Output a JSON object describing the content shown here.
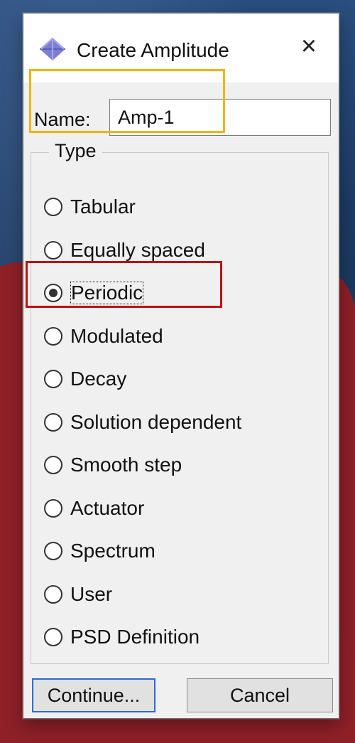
{
  "dialog": {
    "title": "Create Amplitude",
    "close_icon": "close-icon",
    "icon": "amplitude-diamond-icon",
    "name_label": "Name:",
    "name_value": "Amp-1",
    "type_label": "Type",
    "options": [
      {
        "label": "Tabular",
        "selected": false
      },
      {
        "label": "Equally spaced",
        "selected": false
      },
      {
        "label": "Periodic",
        "selected": true
      },
      {
        "label": "Modulated",
        "selected": false
      },
      {
        "label": "Decay",
        "selected": false
      },
      {
        "label": "Solution dependent",
        "selected": false
      },
      {
        "label": "Smooth step",
        "selected": false
      },
      {
        "label": "Actuator",
        "selected": false
      },
      {
        "label": "Spectrum",
        "selected": false
      },
      {
        "label": "User",
        "selected": false
      },
      {
        "label": "PSD Definition",
        "selected": false
      }
    ],
    "continue_label": "Continue...",
    "cancel_label": "Cancel"
  },
  "annotations": {
    "name_highlight_color": "#f2b300",
    "selected_highlight_color": "#bf1010"
  }
}
